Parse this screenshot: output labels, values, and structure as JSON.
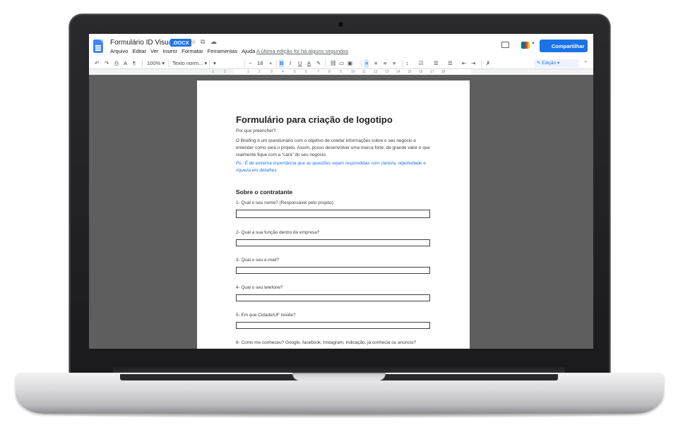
{
  "window": {
    "doc_title": "Formulário ID Visual",
    "doc_badge": ".DOCX",
    "last_edit": "A última edição foi há alguns segundos",
    "share_label": "Compartilhar",
    "share_icon": "person-icon"
  },
  "menu": [
    "Arquivo",
    "Editar",
    "Ver",
    "Inserir",
    "Formatar",
    "Ferramentas",
    "Ajuda"
  ],
  "toolbar": {
    "zoom": "100%",
    "style": "Texto norm...",
    "font_size": "18",
    "mode": "Edição"
  },
  "ruler": [
    "1",
    "2",
    "1",
    "2",
    "3",
    "4",
    "5",
    "6",
    "7",
    "8",
    "9",
    "10",
    "11",
    "12",
    "13",
    "14",
    "15",
    "16",
    "17",
    "18"
  ],
  "document": {
    "heading": "Formulário para criação de logotipo",
    "why_label": "Por que preencher?",
    "intro": "O Briefing é um questionário com o objetivo de coletar informações sobre o seu negócio e entender como será o projeto. Assim, posso desenvolver uma marca forte, de grande valor e que realmente fique com a “cara” do seu negócio.",
    "note": "Ps.: É de extrema importância que as questões sejam respondidas com clareza, objetividade e riqueza em detalhes.",
    "section": "Sobre o contratante",
    "questions": [
      "1- Qual o seu nome? (Responsável pelo projeto)",
      "2- Qual a sua função dentro da empresa?",
      "3- Qual o seu e-mail?",
      "4- Qual o seu telefone?",
      "5- Em que Cidade/UF reside?",
      "6- Como me conheceu? Google, facebook, Instagram, indicação, já conhecia ou anúncio?"
    ]
  },
  "colors": {
    "accent": "#1a73e8",
    "canvas": "#5e5e5e",
    "text": "#202124"
  }
}
